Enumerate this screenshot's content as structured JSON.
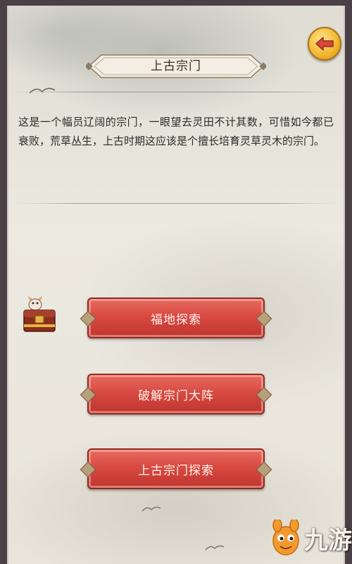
{
  "header": {
    "title": "上古宗门",
    "back_icon": "back-arrow-icon"
  },
  "description": "这是一个幅员辽阔的宗门，一眼望去灵田不计其数，可惜如今都已衰败，荒草丛生，上古时期这应该是个擅长培育灵草灵木的宗门。",
  "actions": [
    {
      "label": "福地探索"
    },
    {
      "label": "破解宗门大阵"
    },
    {
      "label": "上古宗门探索"
    }
  ],
  "watermark": {
    "text": "九游",
    "icon": "jiuyou-logo-icon"
  },
  "colors": {
    "button_red": "#d84a42",
    "back_button_gold": "#f3b52d",
    "parchment": "#ece9e1"
  }
}
